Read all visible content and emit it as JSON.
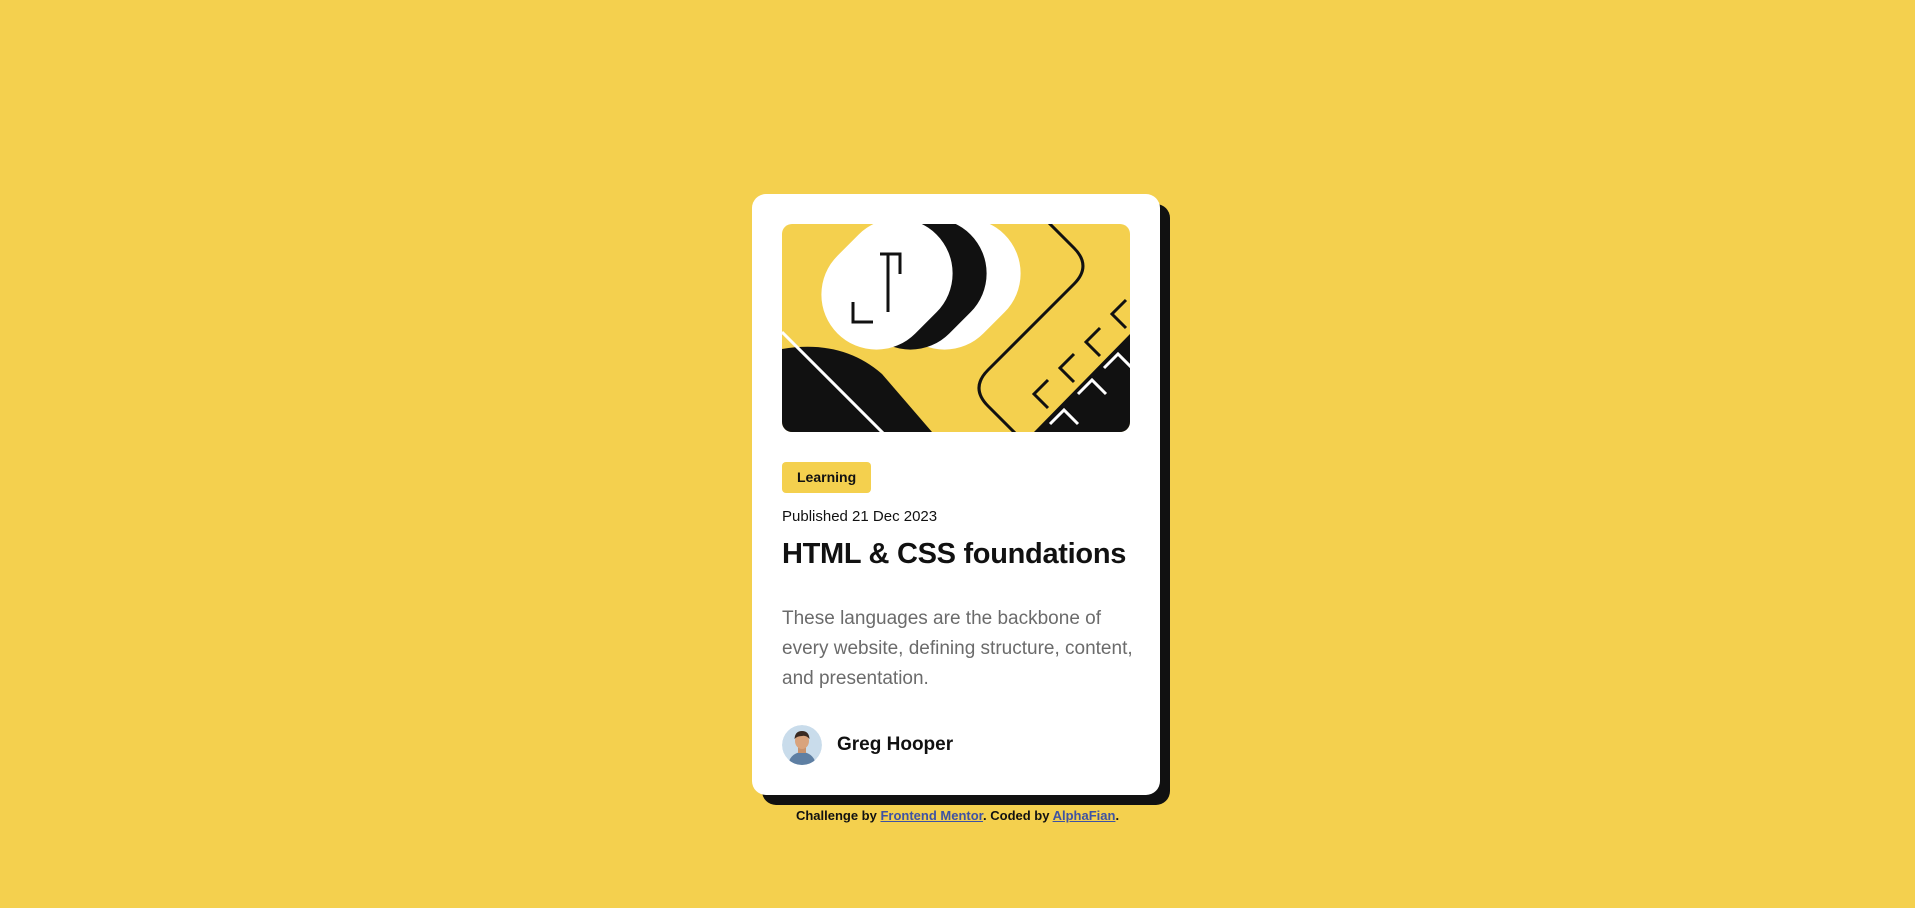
{
  "colors": {
    "background": "#F4D04E",
    "card": "#FFFFFF",
    "shadow": "#111111",
    "text_dark": "#111111",
    "text_muted": "#6B6B6B",
    "link": "#3E52A3"
  },
  "card": {
    "illustration_icon": "abstract-illustration",
    "tag": "Learning",
    "published": "Published 21 Dec 2023",
    "title": "HTML & CSS foundations",
    "description": "These languages are the backbone of every website, defining structure, content, and presentation.",
    "author": {
      "name": "Greg Hooper",
      "avatar_icon": "avatar-icon"
    }
  },
  "attribution": {
    "prefix": "Challenge by ",
    "link1": "Frontend Mentor",
    "middle": ". Coded by ",
    "link2": "AlphaFian",
    "suffix": "."
  }
}
